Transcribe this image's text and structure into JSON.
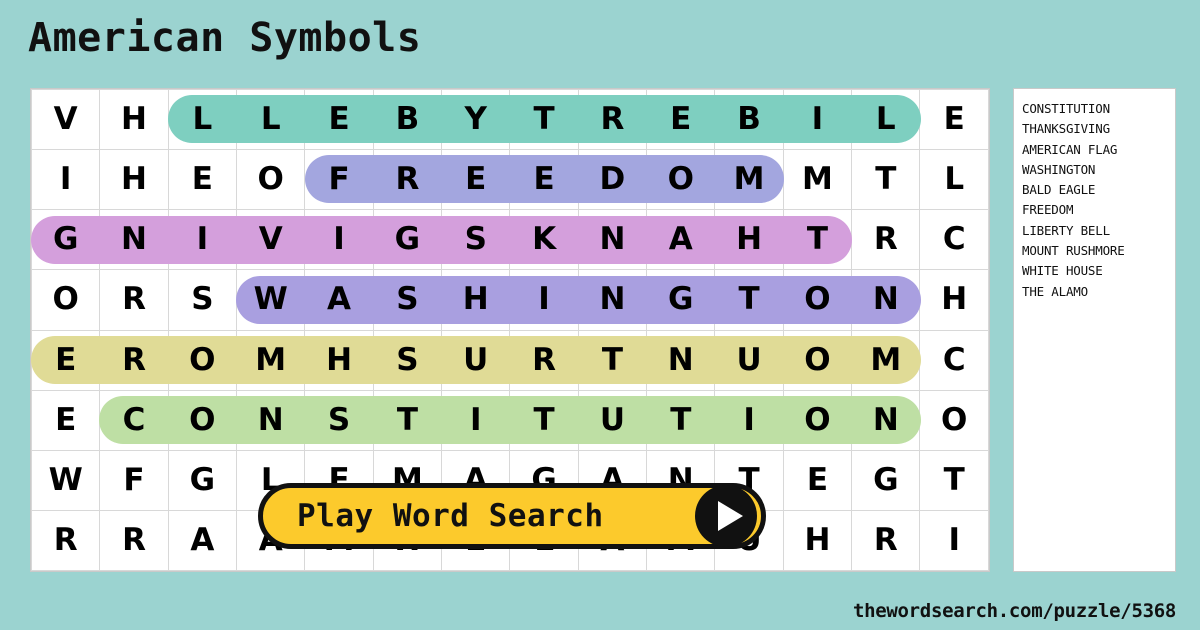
{
  "page": {
    "title": "American Symbols",
    "footer_url": "thewordsearch.com/puzzle/5368",
    "background_color": "#9BD3D0"
  },
  "play_button": {
    "label": "Play Word Search",
    "icon": "play-triangle-icon",
    "background_color": "#FCCA2C"
  },
  "word_list": {
    "words": [
      "CONSTITUTION",
      "THANKSGIVING",
      "AMERICAN FLAG",
      "WASHINGTON",
      "BALD EAGLE",
      "FREEDOM",
      "LIBERTY BELL",
      "MOUNT RUSHMORE",
      "WHITE HOUSE",
      "THE ALAMO"
    ]
  },
  "grid": {
    "rows": 8,
    "cols": 14,
    "letters": [
      [
        "V",
        "H",
        "L",
        "L",
        "E",
        "B",
        "Y",
        "T",
        "R",
        "E",
        "B",
        "I",
        "L",
        "E"
      ],
      [
        "I",
        "H",
        "E",
        "O",
        "F",
        "R",
        "E",
        "E",
        "D",
        "O",
        "M",
        "M",
        "T",
        "L"
      ],
      [
        "G",
        "N",
        "I",
        "V",
        "I",
        "G",
        "S",
        "K",
        "N",
        "A",
        "H",
        "T",
        "R",
        "C"
      ],
      [
        "O",
        "R",
        "S",
        "W",
        "A",
        "S",
        "H",
        "I",
        "N",
        "G",
        "T",
        "O",
        "N",
        "H"
      ],
      [
        "E",
        "R",
        "O",
        "M",
        "H",
        "S",
        "U",
        "R",
        "T",
        "N",
        "U",
        "O",
        "M",
        "C"
      ],
      [
        "E",
        "C",
        "O",
        "N",
        "S",
        "T",
        "I",
        "T",
        "U",
        "T",
        "I",
        "O",
        "N",
        "O"
      ],
      [
        "W",
        "F",
        "G",
        "L",
        "E",
        "M",
        "A",
        "G",
        "A",
        "N",
        "T",
        "E",
        "G",
        "T"
      ],
      [
        "R",
        "R",
        "A",
        "A",
        "M",
        "H",
        "E",
        "L",
        "A",
        "M",
        "U",
        "H",
        "R",
        "I"
      ]
    ],
    "highlights": [
      {
        "word": "LIBERTY BELL",
        "row": 0,
        "col_start": 2,
        "col_end": 12,
        "color": "#7ECFC0"
      },
      {
        "word": "FREEDOM",
        "row": 1,
        "col_start": 4,
        "col_end": 10,
        "color": "#A3A6DF"
      },
      {
        "word": "THANKSGIVING",
        "row": 2,
        "col_start": 0,
        "col_end": 11,
        "color": "#D49FDC"
      },
      {
        "word": "WASHINGTON",
        "row": 3,
        "col_start": 3,
        "col_end": 12,
        "color": "#A99FE0"
      },
      {
        "word": "MOUNT RUSHMORE",
        "row": 4,
        "col_start": 0,
        "col_end": 12,
        "color": "#E0DB96"
      },
      {
        "word": "CONSTITUTION",
        "row": 5,
        "col_start": 1,
        "col_end": 12,
        "color": "#BEDFA4"
      }
    ]
  }
}
